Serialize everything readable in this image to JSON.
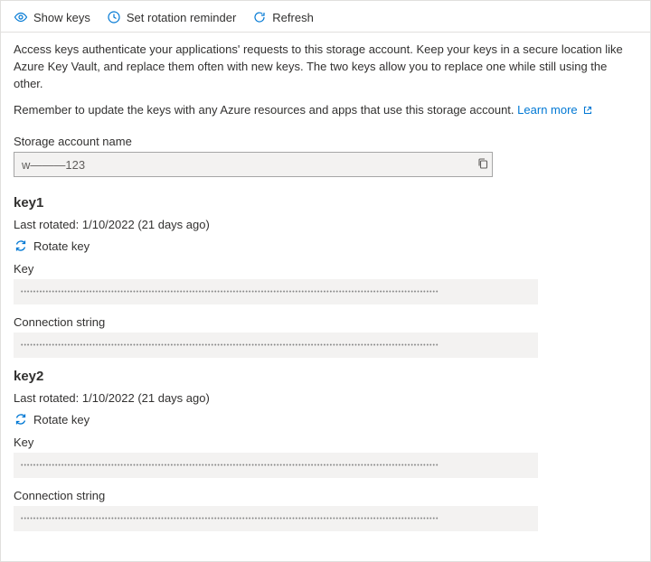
{
  "toolbar": {
    "show_keys": "Show keys",
    "set_rotation": "Set rotation reminder",
    "refresh": "Refresh"
  },
  "description": "Access keys authenticate your applications' requests to this storage account. Keep your keys in a secure location like Azure Key Vault, and replace them often with new keys. The two keys allow you to replace one while still using the other.",
  "remember": "Remember to update the keys with any Azure resources and apps that use this storage account.",
  "learn_more": "Learn more",
  "account_label": "Storage account name",
  "account_value": "w———123",
  "keys": [
    {
      "title": "key1",
      "last_rotated": "Last rotated: 1/10/2022 (21 days ago)",
      "rotate_label": "Rotate key",
      "key_label": "Key",
      "conn_label": "Connection string"
    },
    {
      "title": "key2",
      "last_rotated": "Last rotated: 1/10/2022 (21 days ago)",
      "rotate_label": "Rotate key",
      "key_label": "Key",
      "conn_label": "Connection string"
    }
  ],
  "masked": "••••••••••••••••••••••••••••••••••••••••••••••••••••••••••••••••••••••••••••••••••••••••••••••••••••••••••••••••••••••••••••••••••••••"
}
